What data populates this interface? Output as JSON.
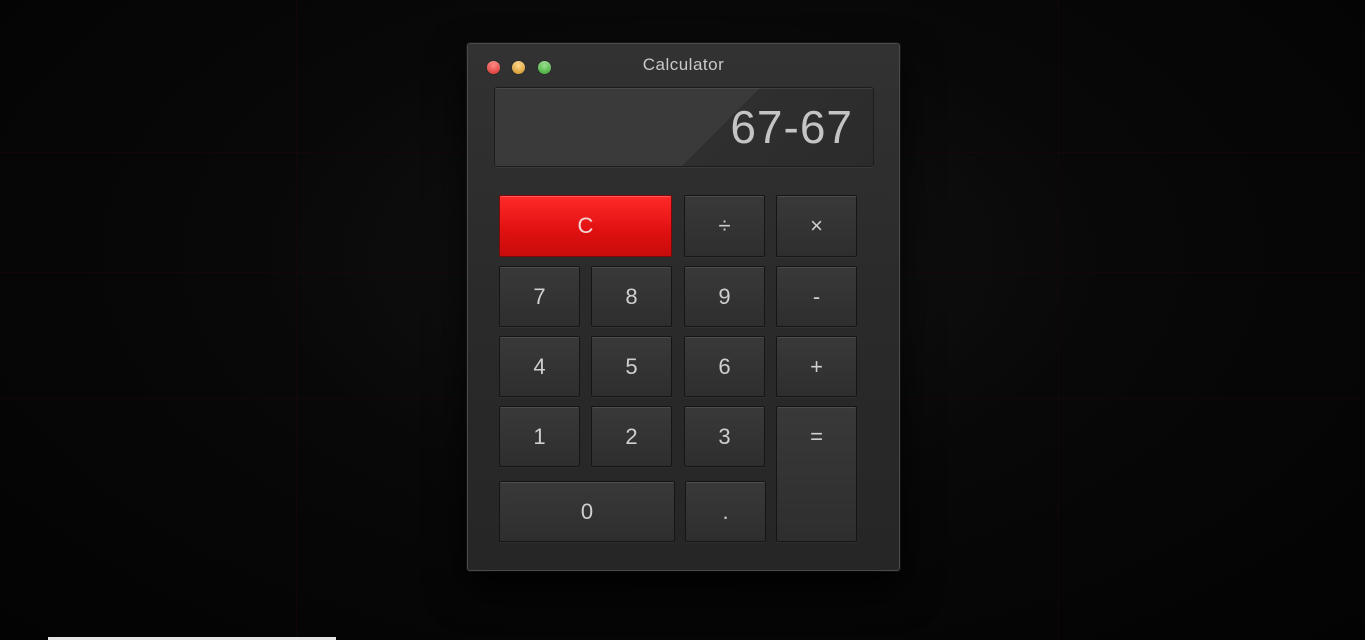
{
  "window": {
    "title": "Calculator"
  },
  "display": {
    "value": "67-67"
  },
  "keys": {
    "clear": "C",
    "divide": "÷",
    "multiply": "×",
    "seven": "7",
    "eight": "8",
    "nine": "9",
    "minus": "-",
    "four": "4",
    "five": "5",
    "six": "6",
    "plus": "+",
    "one": "1",
    "two": "2",
    "three": "3",
    "equals": "=",
    "zero": "0",
    "decimal": "."
  },
  "colors": {
    "clear_button": "#e81414",
    "close": "#e0443e",
    "minimize": "#dba13a",
    "maximize": "#4eb344"
  }
}
